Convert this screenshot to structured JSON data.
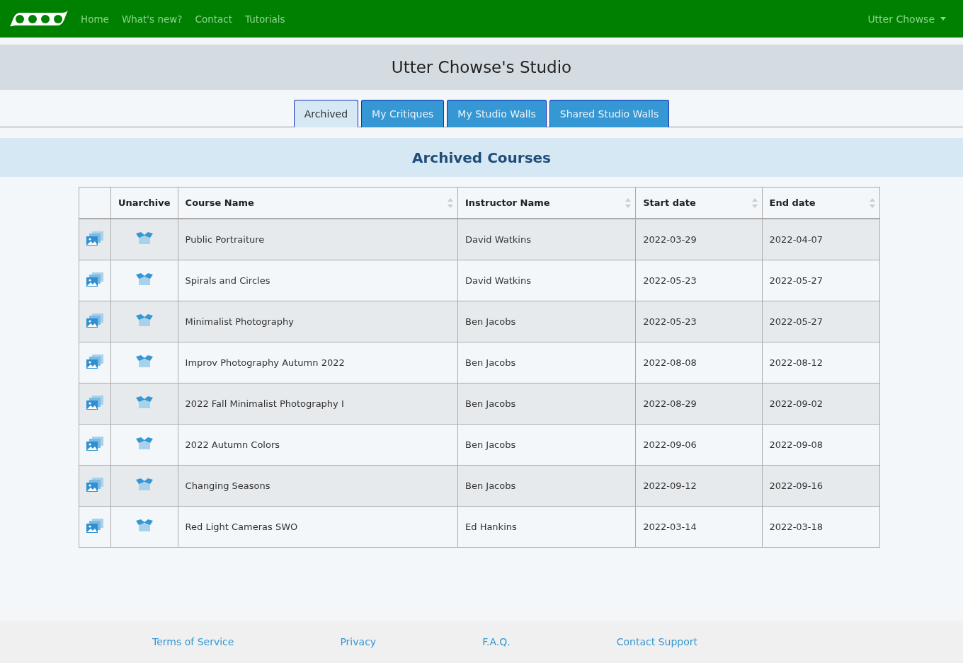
{
  "navbar": {
    "links": [
      "Home",
      "What's new?",
      "Contact",
      "Tutorials"
    ],
    "user": "Utter Chowse"
  },
  "studio_title": "Utter Chowse's Studio",
  "tabs": [
    {
      "label": "Archived",
      "selected": true
    },
    {
      "label": "My Critiques",
      "selected": false
    },
    {
      "label": "My Studio Walls",
      "selected": false
    },
    {
      "label": "Shared Studio Walls",
      "selected": false
    }
  ],
  "section_title": "Archived Courses",
  "table": {
    "columns": [
      {
        "sortable": false
      },
      {
        "label": "Unarchive",
        "sortable": false
      },
      {
        "label": "Course Name",
        "sortable": true
      },
      {
        "label": "Instructor Name",
        "sortable": true
      },
      {
        "label": "Start date",
        "sortable": true
      },
      {
        "label": "End date",
        "sortable": true
      }
    ],
    "rows": [
      {
        "course": "Public Portraiture",
        "instructor": "David Watkins",
        "start": "2022-03-29",
        "end": "2022-04-07"
      },
      {
        "course": "Spirals and Circles",
        "instructor": "David Watkins",
        "start": "2022-05-23",
        "end": "2022-05-27"
      },
      {
        "course": "Minimalist Photography",
        "instructor": "Ben Jacobs",
        "start": "2022-05-23",
        "end": "2022-05-27"
      },
      {
        "course": "Improv Photography Autumn 2022",
        "instructor": "Ben Jacobs",
        "start": "2022-08-08",
        "end": "2022-08-12"
      },
      {
        "course": "2022 Fall Minimalist Photography I",
        "instructor": "Ben Jacobs",
        "start": "2022-08-29",
        "end": "2022-09-02"
      },
      {
        "course": "2022 Autumn Colors",
        "instructor": "Ben Jacobs",
        "start": "2022-09-06",
        "end": "2022-09-08"
      },
      {
        "course": "Changing Seasons",
        "instructor": "Ben Jacobs",
        "start": "2022-09-12",
        "end": "2022-09-16"
      },
      {
        "course": "Red Light Cameras SWO",
        "instructor": "Ed Hankins",
        "start": "2022-03-14",
        "end": "2022-03-18"
      }
    ]
  },
  "footer": [
    "Terms of Service",
    "Privacy",
    "F.A.Q.",
    "Contact Support"
  ]
}
